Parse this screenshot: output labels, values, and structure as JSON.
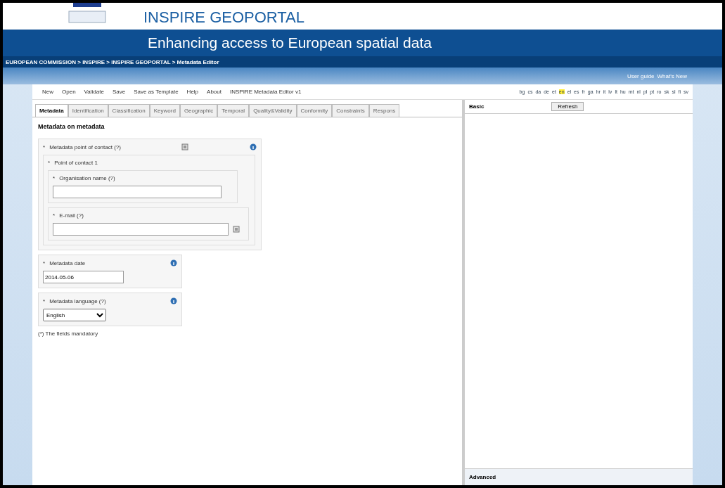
{
  "header": {
    "title": "INSPIRE GEOPORTAL",
    "subtitle": "Enhancing access to European spatial data",
    "breadcrumb": "EUROPEAN COMMISSION > INSPIRE > INSPIRE GEOPORTAL > Metadata Editor",
    "links": [
      "User guide",
      "What's New"
    ]
  },
  "menu": [
    "New",
    "Open",
    "Validate",
    "Save",
    "Save as Template",
    "Help",
    "About",
    "INSPIRE Metadata Editor v1"
  ],
  "languages": [
    {
      "code": "bg",
      "selected": false
    },
    {
      "code": "cs",
      "selected": false
    },
    {
      "code": "da",
      "selected": false
    },
    {
      "code": "de",
      "selected": false
    },
    {
      "code": "et",
      "selected": false
    },
    {
      "code": "en",
      "selected": true
    },
    {
      "code": "el",
      "selected": false
    },
    {
      "code": "es",
      "selected": false
    },
    {
      "code": "fr",
      "selected": false
    },
    {
      "code": "ga",
      "selected": false
    },
    {
      "code": "hr",
      "selected": false
    },
    {
      "code": "it",
      "selected": false
    },
    {
      "code": "lv",
      "selected": false
    },
    {
      "code": "lt",
      "selected": false
    },
    {
      "code": "hu",
      "selected": false
    },
    {
      "code": "mt",
      "selected": false
    },
    {
      "code": "nl",
      "selected": false
    },
    {
      "code": "pl",
      "selected": false
    },
    {
      "code": "pt",
      "selected": false
    },
    {
      "code": "ro",
      "selected": false
    },
    {
      "code": "sk",
      "selected": false
    },
    {
      "code": "sl",
      "selected": false
    },
    {
      "code": "fi",
      "selected": false
    },
    {
      "code": "sv",
      "selected": false
    }
  ],
  "tabs": [
    {
      "label": "Metadata",
      "selected": true
    },
    {
      "label": "Identification",
      "selected": false
    },
    {
      "label": "Classification",
      "selected": false
    },
    {
      "label": "Keyword",
      "selected": false
    },
    {
      "label": "Geographic",
      "selected": false
    },
    {
      "label": "Temporal",
      "selected": false
    },
    {
      "label": "Quality&Validity",
      "selected": false
    },
    {
      "label": "Conformity",
      "selected": false
    },
    {
      "label": "Constraints",
      "selected": false
    },
    {
      "label": "Respons",
      "selected": false
    }
  ],
  "section_title": "Metadata on metadata",
  "contact": {
    "label": "Metadata point of contact (?)",
    "group": "Point of contact 1",
    "organisation": "Organisation name (?)",
    "email": "E-mail (?)"
  },
  "date": {
    "label": "Metadata date",
    "value": "2014-05-06"
  },
  "language": {
    "label": "Metadata language (?)",
    "value": "English"
  },
  "required_marker": "*",
  "footnote": "(*) The fields mandatory",
  "right_panel": {
    "title": "Basic",
    "button": "Refresh",
    "footer": "Advanced"
  }
}
